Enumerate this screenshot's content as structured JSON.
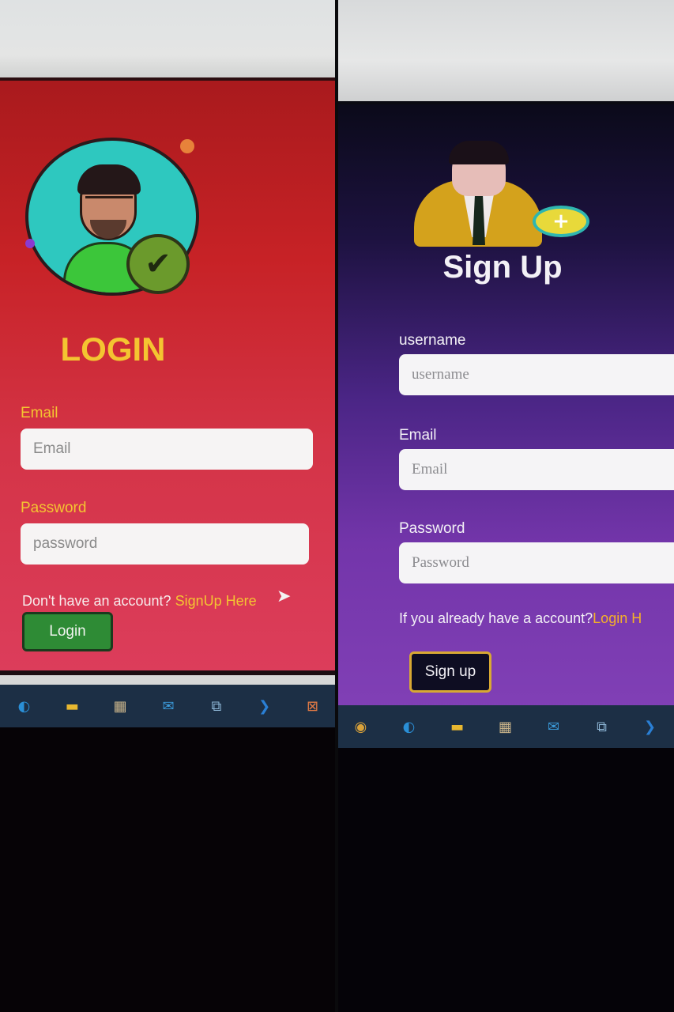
{
  "login_panel": {
    "title": "LOGIN",
    "email_label": "Email",
    "email_placeholder": "Email",
    "password_label": "Password",
    "password_placeholder": "password",
    "prompt_text": "Don't have an account? ",
    "signup_link": "SignUp Here",
    "login_button": "Login",
    "check_glyph": "✔",
    "cursor_glyph": "➤"
  },
  "signup_panel": {
    "title": "Sign Up",
    "username_label": "username",
    "username_placeholder": "username",
    "email_label": "Email",
    "email_placeholder": "Email",
    "password_label": "Password",
    "password_placeholder": "Password",
    "prompt_text": "If you already have a account?",
    "login_link": "Login H",
    "signup_button": "Sign up",
    "plus_glyph": "+"
  },
  "taskbar_left": {
    "icons": [
      {
        "name": "edge-icon",
        "glyph": "◐",
        "color": "#2a8fd6"
      },
      {
        "name": "file-explorer-icon",
        "glyph": "▬",
        "color": "#e8b830"
      },
      {
        "name": "store-icon",
        "glyph": "▦",
        "color": "#c9b48a"
      },
      {
        "name": "mail-icon",
        "glyph": "✉",
        "color": "#3b9ad9"
      },
      {
        "name": "python-icon",
        "glyph": "⧉",
        "color": "#8fb8d8"
      },
      {
        "name": "vscode-icon",
        "glyph": "❯",
        "color": "#2a7fd4"
      },
      {
        "name": "xampp-icon",
        "glyph": "⊠",
        "color": "#e07a45"
      }
    ]
  },
  "taskbar_right": {
    "icons": [
      {
        "name": "chrome-icon",
        "glyph": "◉",
        "color": "#d9a23a"
      },
      {
        "name": "edge-icon",
        "glyph": "◐",
        "color": "#2a8fd6"
      },
      {
        "name": "file-explorer-icon",
        "glyph": "▬",
        "color": "#e8b830"
      },
      {
        "name": "store-icon",
        "glyph": "▦",
        "color": "#c9b48a"
      },
      {
        "name": "mail-icon",
        "glyph": "✉",
        "color": "#3b9ad9"
      },
      {
        "name": "python-icon",
        "glyph": "⧉",
        "color": "#8fb8d8"
      },
      {
        "name": "vscode-icon",
        "glyph": "❯",
        "color": "#2a7fd4"
      }
    ]
  }
}
